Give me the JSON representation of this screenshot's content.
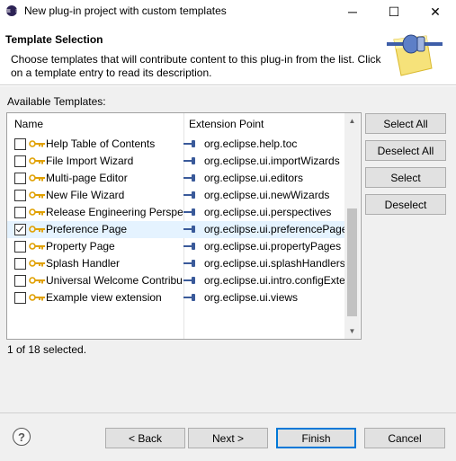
{
  "window": {
    "title": "New plug-in project with custom templates",
    "minimize": "─",
    "maximize": "☐",
    "close": "✕"
  },
  "header": {
    "title": "Template Selection",
    "description": "Choose templates that will contribute content to this plug-in from the list. Click on a template entry to read its description."
  },
  "available_label": "Available Templates:",
  "table": {
    "col_name": "Name",
    "col_ext": "Extension Point",
    "rows": [
      {
        "name": "Help Table of Contents",
        "ext": "org.eclipse.help.toc",
        "checked": false
      },
      {
        "name": "File Import Wizard",
        "ext": "org.eclipse.ui.importWizards",
        "checked": false
      },
      {
        "name": "Multi-page Editor",
        "ext": "org.eclipse.ui.editors",
        "checked": false
      },
      {
        "name": "New File Wizard",
        "ext": "org.eclipse.ui.newWizards",
        "checked": false
      },
      {
        "name": "Release Engineering Perspective",
        "ext": "org.eclipse.ui.perspectives",
        "checked": false
      },
      {
        "name": "Preference Page",
        "ext": "org.eclipse.ui.preferencePages",
        "checked": true
      },
      {
        "name": "Property Page",
        "ext": "org.eclipse.ui.propertyPages",
        "checked": false
      },
      {
        "name": "Splash Handler",
        "ext": "org.eclipse.ui.splashHandlers",
        "checked": false
      },
      {
        "name": "Universal Welcome Contribution",
        "ext": "org.eclipse.ui.intro.configExtension",
        "checked": false
      },
      {
        "name": "Example view extension",
        "ext": "org.eclipse.ui.views",
        "checked": false
      }
    ]
  },
  "side_buttons": {
    "select_all": "Select All",
    "deselect_all": "Deselect All",
    "select": "Select",
    "deselect": "Deselect"
  },
  "status": "1 of 18 selected.",
  "footer": {
    "help": "?",
    "back": "< Back",
    "next": "Next >",
    "finish": "Finish",
    "cancel": "Cancel"
  },
  "colors": {
    "selection": "#e5f3ff",
    "primary_border": "#0078d7",
    "key_icon": "#e0a000",
    "plug_icon": "#3a5a9a"
  }
}
